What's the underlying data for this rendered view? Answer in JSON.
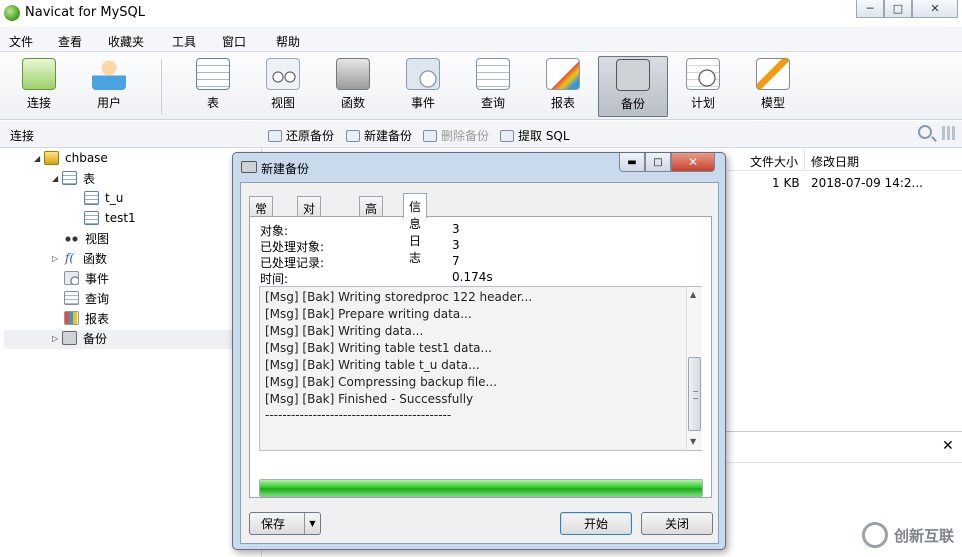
{
  "window": {
    "title": "Navicat for MySQL",
    "minimize": "─",
    "maximize": "□",
    "close": "✕"
  },
  "menu": [
    "文件",
    "查看",
    "收藏夹",
    "工具",
    "窗口",
    "帮助"
  ],
  "toolbar": {
    "connect": "连接",
    "user": "用户",
    "table": "表",
    "view": "视图",
    "function": "函数",
    "event": "事件",
    "query": "查询",
    "report": "报表",
    "backup": "备份",
    "schedule": "计划",
    "model": "模型",
    "active": "备份"
  },
  "subbar": {
    "connection_label": "连接",
    "restore": "还原备份",
    "new_backup": "新建备份",
    "delete_backup": "删除备份",
    "extract_sql": "提取 SQL"
  },
  "tree": {
    "database": "chbase",
    "tables_group": "表",
    "tables": [
      "t_u",
      "test1"
    ],
    "views": "视图",
    "functions": "函数",
    "events": "事件",
    "queries": "查询",
    "reports": "报表",
    "backups": "备份"
  },
  "right_pane": {
    "col_size": "文件大小",
    "col_modified": "修改日期",
    "row_size": "1 KB",
    "row_modified": "2018-07-09 14:2..."
  },
  "dialog": {
    "title": "新建备份",
    "tabs": [
      "常规",
      "对象选择",
      "高级",
      "信息日志"
    ],
    "active_tab": "信息日志",
    "stats": [
      {
        "label": "对象:",
        "value": "3"
      },
      {
        "label": "已处理对象:",
        "value": "3"
      },
      {
        "label": "已处理记录:",
        "value": "7"
      },
      {
        "label": "时间:",
        "value": "0.174s"
      }
    ],
    "log": [
      "[Msg] [Bak] Writing storedproc 122 header...",
      "[Msg] [Bak] Prepare writing data...",
      "[Msg] [Bak] Writing data...",
      "[Msg] [Bak] Writing table test1 data...",
      "[Msg] [Bak] Writing table t_u data...",
      "[Msg] [Bak] Compressing backup file...",
      "[Msg] [Bak] Finished - Successfully",
      "-------------------------------------------"
    ],
    "progress_percent": 100,
    "save_button": "保存",
    "start_button": "开始",
    "close_button": "关闭"
  },
  "watermark": "创新互联",
  "colors": {
    "progress_green": "#2fcb2f",
    "dialog_frame": "#c9daec",
    "close_red": "#c8412b"
  }
}
